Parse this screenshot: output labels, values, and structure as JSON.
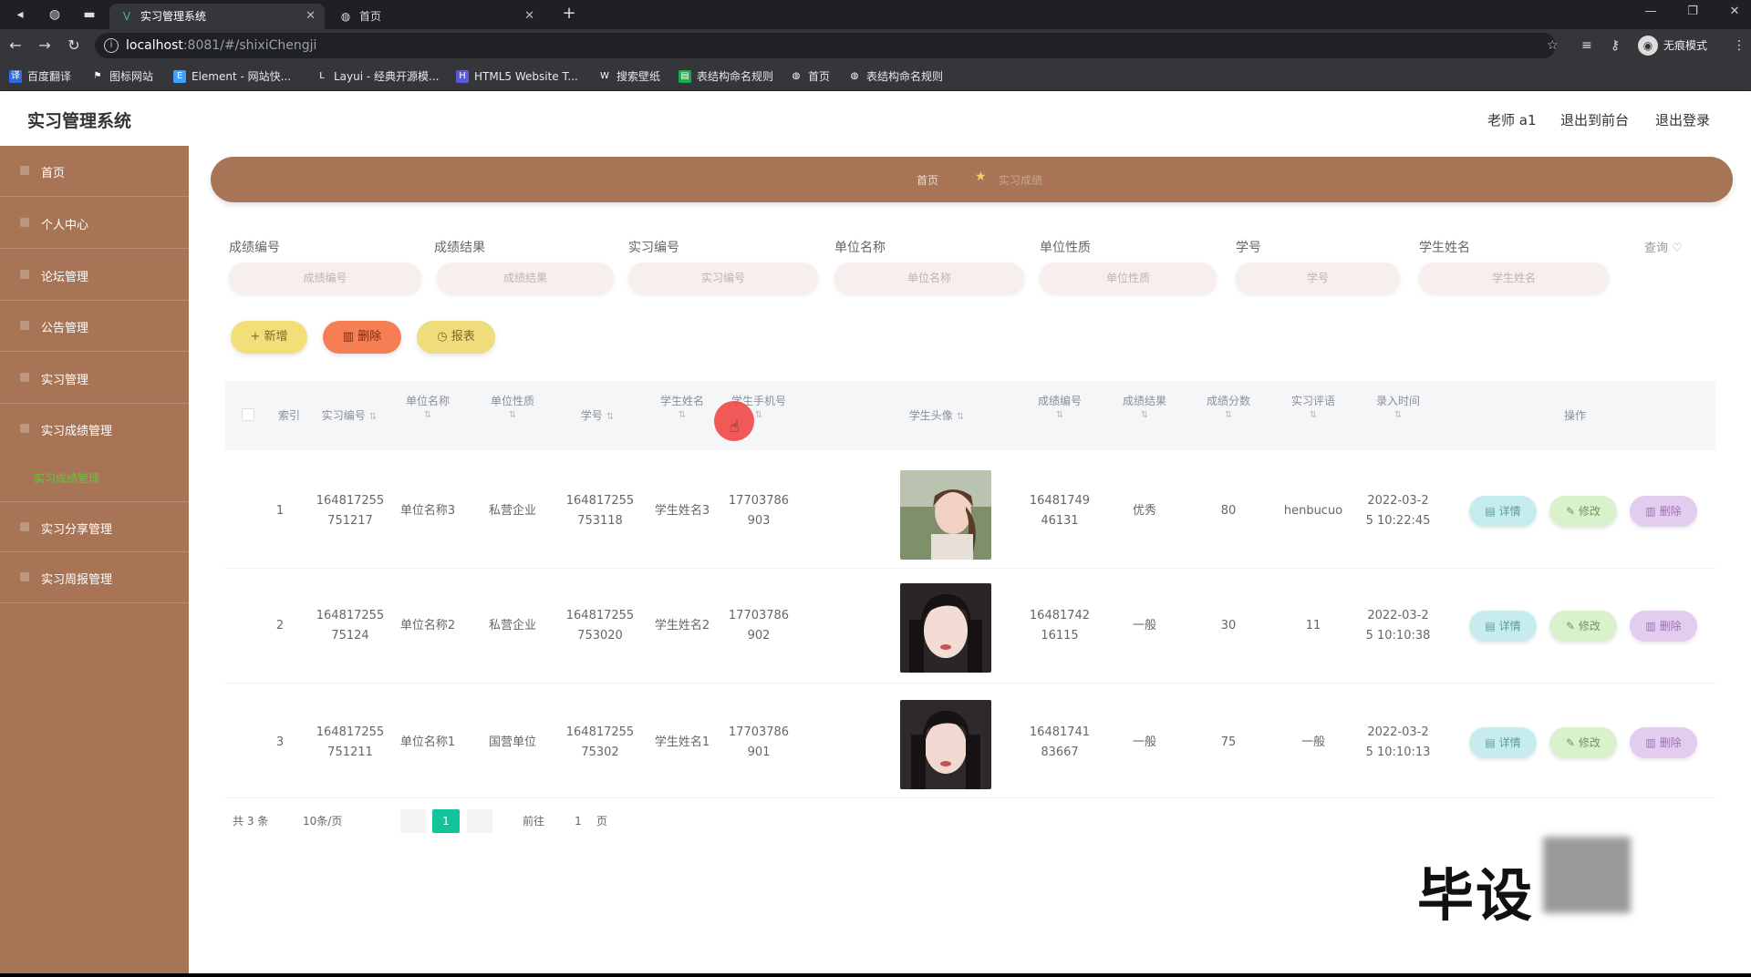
{
  "browser": {
    "tabs": [
      {
        "title": "实习管理系统",
        "active": true,
        "icon": "vue-logo-icon"
      },
      {
        "title": "首页",
        "active": false,
        "icon": "globe-icon"
      }
    ],
    "url_host": "localhost",
    "url_path": ":8081/#/shixiChengji",
    "incognito_label": "无痕模式",
    "bookmarks": [
      "百度翻译",
      "图标网站",
      "Element - 网站快...",
      "Layui - 经典开源模...",
      "HTML5 Website T...",
      "搜索壁纸",
      "表结构命名规则",
      "首页",
      "表结构命名规则"
    ]
  },
  "app": {
    "title": "实习管理系统",
    "header_links": [
      "老师 a1",
      "退出到前台",
      "退出登录"
    ]
  },
  "sidebar": {
    "items": [
      "首页",
      "个人中心",
      "论坛管理",
      "公告管理",
      "实习管理",
      "实习成绩管理",
      "实习分享管理",
      "实习周报管理"
    ],
    "active_submenu": "实习成绩管理"
  },
  "breadcrumb": {
    "home": "首页",
    "current": "实习成绩"
  },
  "filters": {
    "labels": [
      "成绩编号",
      "成绩结果",
      "实习编号",
      "单位名称",
      "单位性质",
      "学号",
      "学生姓名"
    ],
    "placeholders": [
      "成绩编号",
      "成绩结果",
      "实习编号",
      "单位名称",
      "单位性质",
      "学号",
      "学生姓名"
    ],
    "search_label": "查询"
  },
  "actions": {
    "add": "+ 新增",
    "delete": "删除",
    "report": "报表"
  },
  "table": {
    "headers": [
      "索引",
      "实习编号",
      "单位名称",
      "单位性质",
      "学号",
      "学生姓名",
      "学生手机号",
      "学生头像",
      "成绩编号",
      "成绩结果",
      "成绩分数",
      "实习评语",
      "录入时间",
      "操作"
    ],
    "rows": [
      {
        "index": "1",
        "intern_no": [
          "164817255",
          "751217"
        ],
        "unit": "单位名称3",
        "nature": "私营企业",
        "student_no": [
          "164817255",
          "753118"
        ],
        "name": "学生姓名3",
        "phone": [
          "17703786",
          "903"
        ],
        "score_no": [
          "16481749",
          "46131"
        ],
        "result": "优秀",
        "score": "80",
        "comment": "henbucuo",
        "time": [
          "2022-03-2",
          "5 10:22:45"
        ]
      },
      {
        "index": "2",
        "intern_no": [
          "164817255",
          "75124"
        ],
        "unit": "单位名称2",
        "nature": "私营企业",
        "student_no": [
          "164817255",
          "753020"
        ],
        "name": "学生姓名2",
        "phone": [
          "17703786",
          "902"
        ],
        "score_no": [
          "16481742",
          "16115"
        ],
        "result": "一般",
        "score": "30",
        "comment": "11",
        "time": [
          "2022-03-2",
          "5 10:10:38"
        ]
      },
      {
        "index": "3",
        "intern_no": [
          "164817255",
          "751211"
        ],
        "unit": "单位名称1",
        "nature": "国营单位",
        "student_no": [
          "164817255",
          "75302"
        ],
        "name": "学生姓名1",
        "phone": [
          "17703786",
          "901"
        ],
        "score_no": [
          "16481741",
          "83667"
        ],
        "result": "一般",
        "score": "75",
        "comment": "一般",
        "time": [
          "2022-03-2",
          "5 10:10:13"
        ]
      }
    ],
    "op_labels": {
      "detail": "详情",
      "edit": "修改",
      "delete": "删除"
    }
  },
  "pagination": {
    "total": "共 3 条",
    "page_size": "10条/页",
    "current": "1",
    "goto": "前往",
    "goto_value": "1",
    "page_unit": "页"
  },
  "watermark": "毕设"
}
